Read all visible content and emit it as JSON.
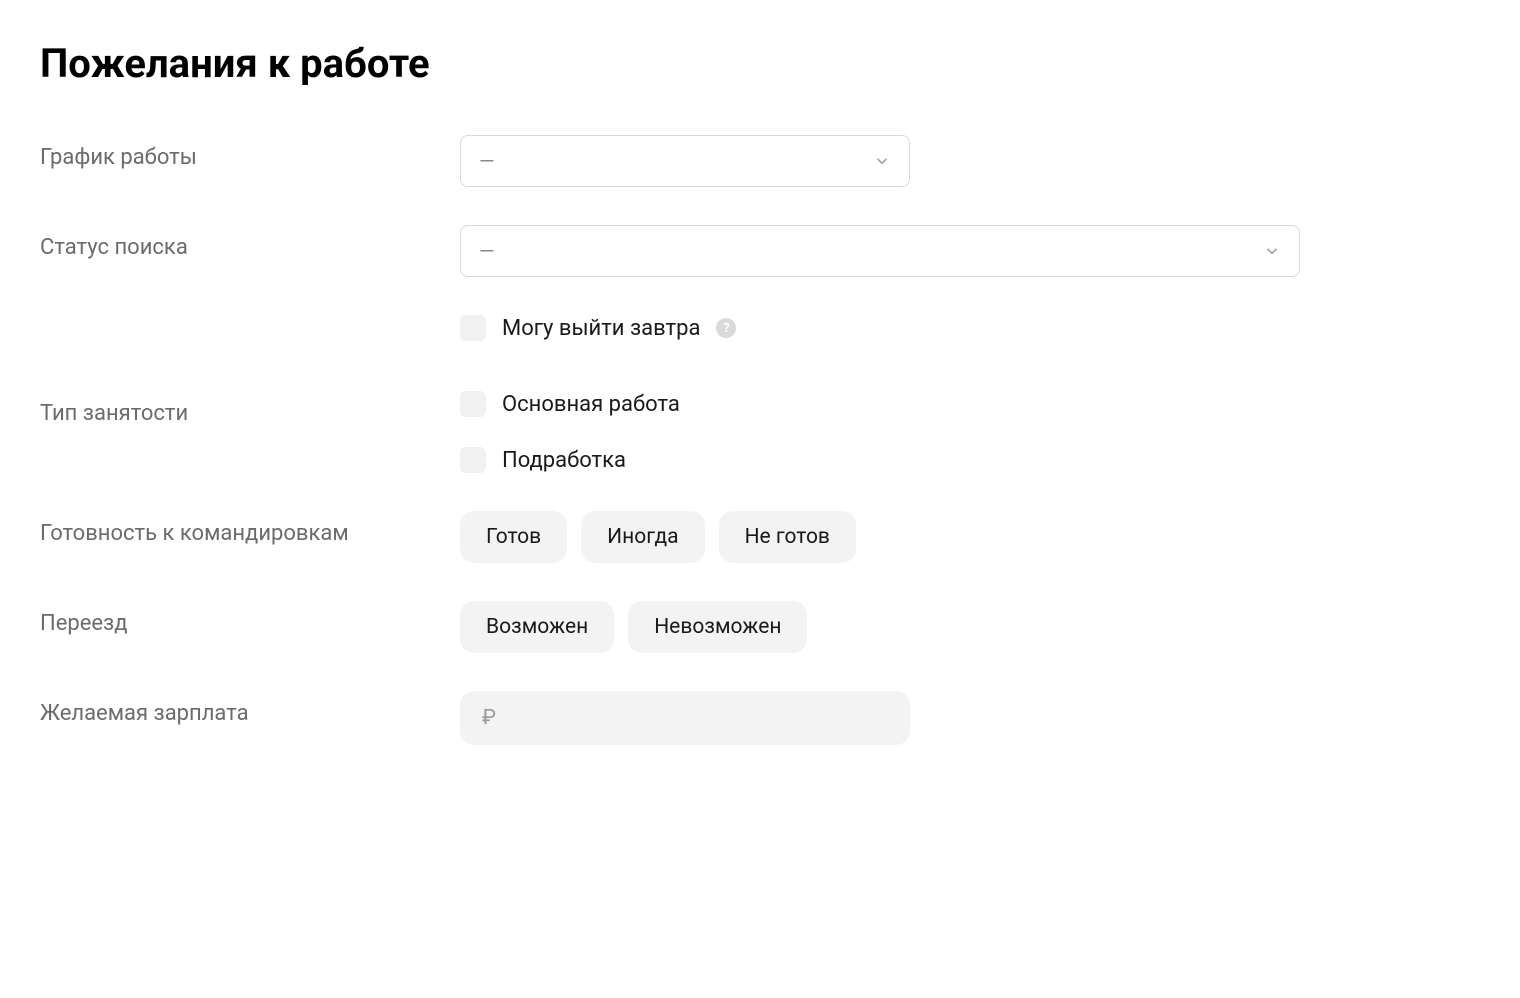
{
  "title": "Пожелания к работе",
  "labels": {
    "schedule": "График работы",
    "search_status": "Статус поиска",
    "employment_type": "Тип занятости",
    "business_trips": "Готовность к командировкам",
    "relocation": "Переезд",
    "desired_salary": "Желаемая зарплата"
  },
  "placeholders": {
    "select_empty": "—",
    "salary": "₽"
  },
  "checkboxes": {
    "can_start_tomorrow": "Могу выйти завтра",
    "main_job": "Основная работа",
    "part_time": "Подработка"
  },
  "help_icon_text": "?",
  "business_trip_options": {
    "ready": "Готов",
    "sometimes": "Иногда",
    "not_ready": "Не готов"
  },
  "relocation_options": {
    "possible": "Возможен",
    "impossible": "Невозможен"
  }
}
